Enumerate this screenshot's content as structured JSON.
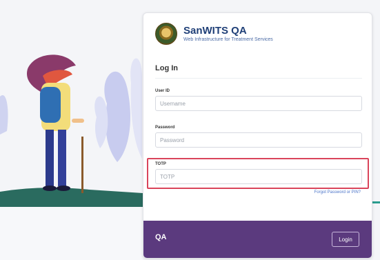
{
  "app": {
    "title": "SanWITS QA",
    "subtitle": "Web Infrastructure for Treatment Services",
    "logo_icon": "state-seal-icon"
  },
  "login": {
    "heading": "Log In",
    "user_id": {
      "label": "User ID",
      "placeholder": "Username",
      "value": ""
    },
    "password": {
      "label": "Password",
      "placeholder": "Password",
      "value": ""
    },
    "totp": {
      "label": "TOTP",
      "placeholder": "TOTP",
      "value": ""
    },
    "forgot_link": "Forgot Password or PIN?"
  },
  "footer": {
    "environment": "QA",
    "login_button": "Login"
  },
  "colors": {
    "brand_title": "#1f3f77",
    "footer_bg": "#5b3a7e",
    "highlight_border": "#d9435a",
    "link": "#4a73c8"
  }
}
